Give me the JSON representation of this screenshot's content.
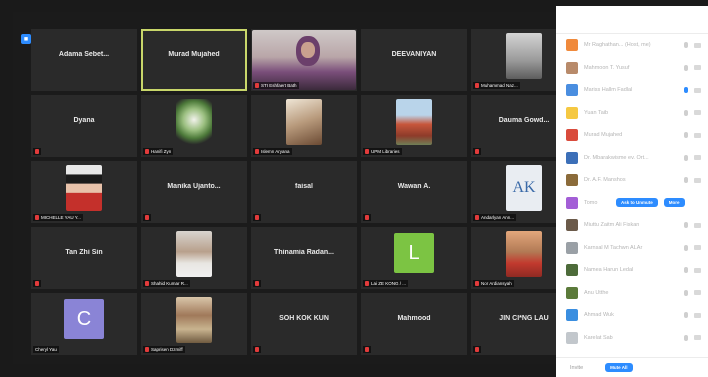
{
  "gallery": {
    "badge_letter": "■",
    "tiles": [
      {
        "name": "Adama Sebet..."
      },
      {
        "name": "Murad Mujahed"
      },
      {
        "label": "STI Eshfaert Bath"
      },
      {
        "name": "DEEVANIYAN"
      },
      {
        "label": "Muhammad Naz..."
      },
      {
        "name": "Dyana"
      },
      {
        "label": "Hanifi Zyn"
      },
      {
        "label": "Islemn Aryana"
      },
      {
        "label": "UPM Libraries"
      },
      {
        "name": "Dauma Gowd..."
      },
      {
        "label": "MICHELLE YAU Y..."
      },
      {
        "name": "Manika Ujanto..."
      },
      {
        "name": "faisal"
      },
      {
        "name": "Wawan A."
      },
      {
        "label": "Andarlyan Ann..."
      },
      {
        "name": "Tan Zhi Sin"
      },
      {
        "label": "Shahid Kumar R..."
      },
      {
        "name": "Thinamia Radan..."
      },
      {
        "letter": "L",
        "label": "Lai ZE KONG / ..."
      },
      {
        "label": "Nor Ardiansyah"
      },
      {
        "letter": "C",
        "label": "Cheryl Yau"
      },
      {
        "label": "Saprisen Dzmiff"
      },
      {
        "name": "SOH KOK KUN"
      },
      {
        "name": "Mahmood"
      },
      {
        "name": "JIN CI*NG LAU"
      }
    ]
  },
  "sidebar": {
    "participants": [
      {
        "name": "Mr Raghathan... (Host, me)"
      },
      {
        "name": "Mahmoon T. Yusuf"
      },
      {
        "name": "Mariss Hallm Fadlal"
      },
      {
        "name": "Yuan Taib"
      },
      {
        "name": "Murad Mujahed"
      },
      {
        "name": "Dr. Mbarakwisme ev. Ort..."
      },
      {
        "name": "Dr. A.F. Manshos"
      },
      {
        "name": "Tomo",
        "ask_label": "Ask to Unmute",
        "more_label": "More"
      },
      {
        "name": "Miuttu Zaitm Ali Fiskan"
      },
      {
        "name": "Karnsal M Tachwn ALAr"
      },
      {
        "name": "Namea Harun Ledal"
      },
      {
        "name": "Anu Utthe"
      },
      {
        "name": "Ahmad Wuk"
      },
      {
        "name": "Karelat Sab"
      }
    ],
    "footer": {
      "invite_label": "Invite",
      "mute_all_label": "Mute All"
    }
  },
  "colors": {
    "active_outline": "#c8d66a",
    "accent_blue": "#2d8cff",
    "muted_red": "#e23b3b"
  }
}
